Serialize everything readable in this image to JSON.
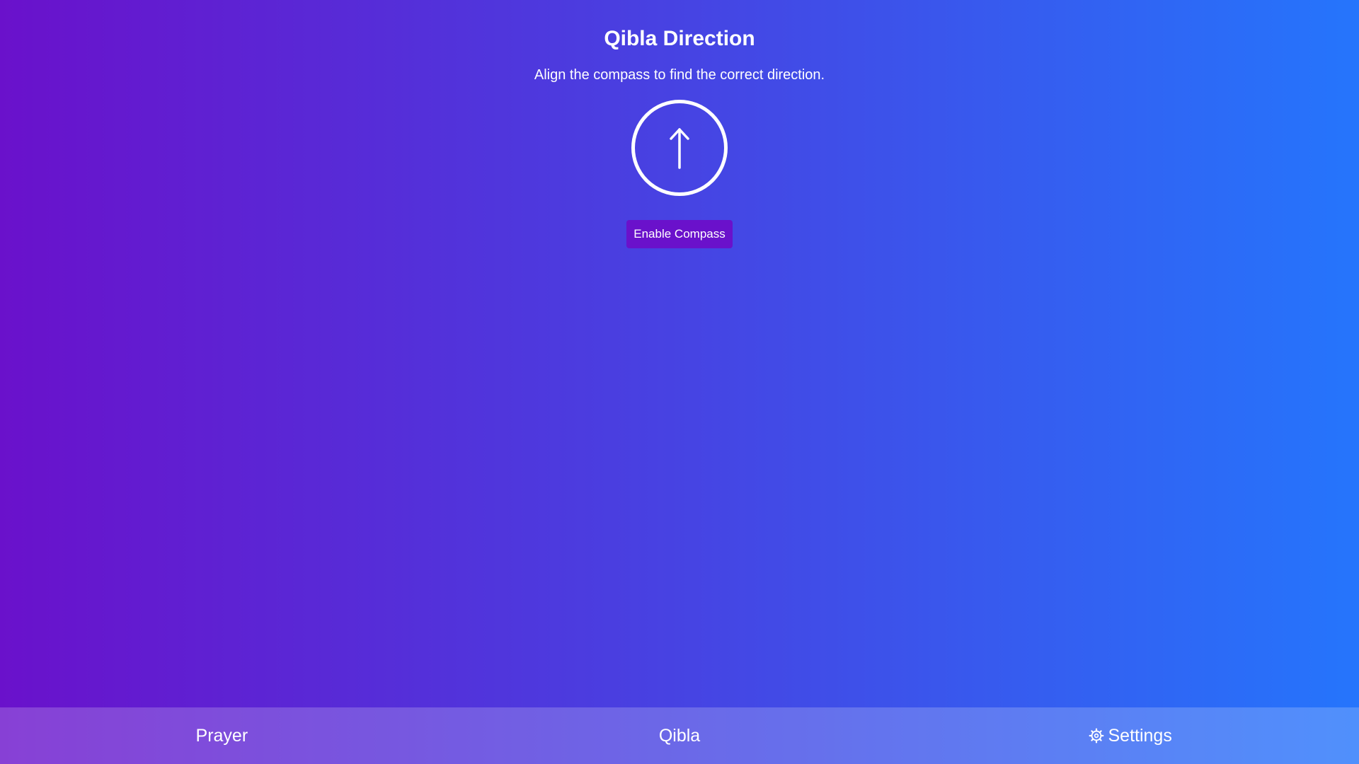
{
  "main": {
    "title": "Qibla Direction",
    "subtitle": "Align the compass to find the correct direction.",
    "compass_icon": "up-arrow-icon",
    "enable_button_label": "Enable Compass"
  },
  "colors": {
    "gradient_start": "#6a11cb",
    "gradient_end": "#2575fc",
    "button_bg": "#6a11cb",
    "text": "#ffffff"
  },
  "bottom_nav": {
    "items": [
      {
        "label": "Prayer",
        "icon": ""
      },
      {
        "label": "Qibla",
        "icon": ""
      },
      {
        "label": "Settings",
        "icon": "gear-icon"
      }
    ]
  }
}
